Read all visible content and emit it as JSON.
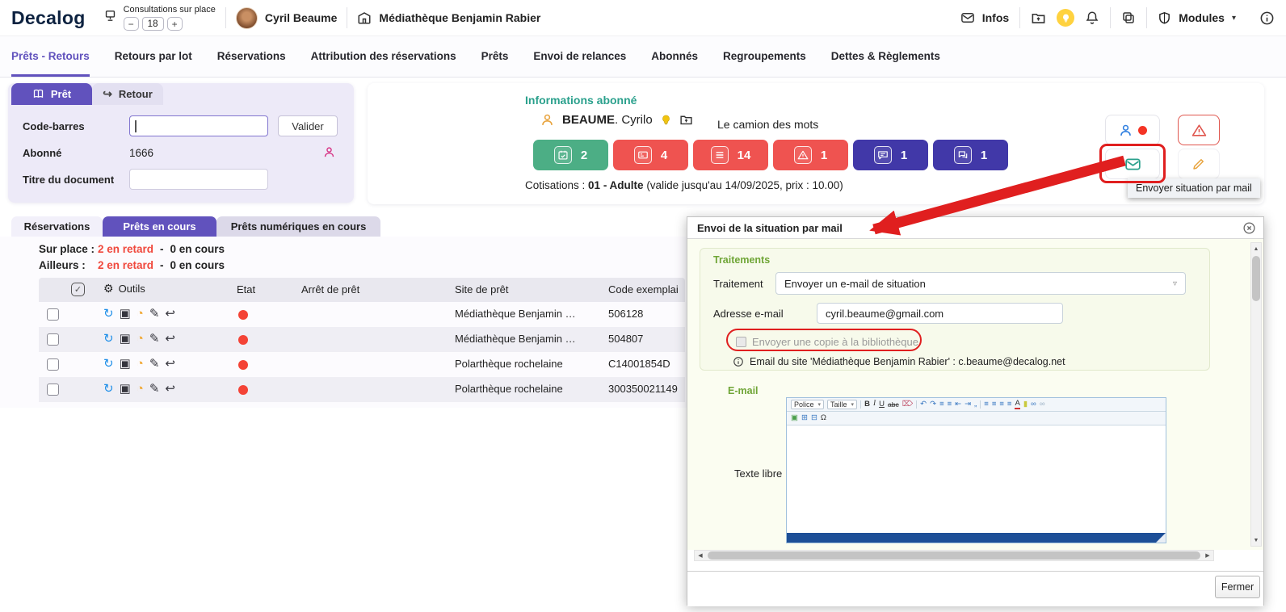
{
  "colors": {
    "accent_purple": "#6152bd",
    "teal_heading": "#2aa08c",
    "badge_green": "#4cae85",
    "badge_red": "#ef5350",
    "badge_indigo": "#4138a8",
    "status_red": "#f44336",
    "annotation_red": "#e01f1f",
    "green_section_title": "#6fa536"
  },
  "header": {
    "logo": "Decalog",
    "consultations": {
      "label": "Consultations sur place",
      "count": "18",
      "minus": "−",
      "plus": "+"
    },
    "user_name": "Cyril Beaume",
    "site_name": "Médiathèque Benjamin Rabier",
    "infos_label": "Infos",
    "modules_label": "Modules"
  },
  "nav": {
    "tabs": [
      {
        "label": "Prêts - Retours",
        "active": true
      },
      {
        "label": "Retours par lot"
      },
      {
        "label": "Réservations"
      },
      {
        "label": "Attribution des réservations"
      },
      {
        "label": "Prêts"
      },
      {
        "label": "Envoi de relances"
      },
      {
        "label": "Abonnés"
      },
      {
        "label": "Regroupements"
      },
      {
        "label": "Dettes & Règlements"
      }
    ]
  },
  "loan_panel": {
    "tab_pret": "Prêt",
    "tab_retour": "Retour",
    "barcode_label": "Code-barres",
    "valider_label": "Valider",
    "abonne_label": "Abonné",
    "abonne_value": "1666",
    "titre_label": "Titre du document"
  },
  "subscriber": {
    "section_title": "Informations abonné",
    "name_bold": "BEAUME",
    "name_rest": ". Cyrilo",
    "subtitle": "Le camion des mots",
    "badges": [
      {
        "icon": "calendar-check",
        "value": "2"
      },
      {
        "icon": "card",
        "value": "4"
      },
      {
        "icon": "books",
        "value": "14"
      },
      {
        "icon": "warning",
        "value": "1"
      },
      {
        "icon": "comment",
        "value": "1"
      },
      {
        "icon": "chat",
        "value": "1"
      }
    ],
    "cotisations_prefix": "Cotisations : ",
    "cotisations_bold": "01 - Adulte",
    "cotisations_suffix": " (valide jusqu'au 14/09/2025, prix : 10.00)",
    "tooltip": "Envoyer situation par mail"
  },
  "loans": {
    "tabs": [
      {
        "label": "Réservations"
      },
      {
        "label": "Prêts en cours",
        "active": true
      },
      {
        "label": "Prêts numériques en cours"
      }
    ],
    "summary": [
      {
        "label": "Sur place :",
        "late": "2 en retard",
        "sep": "-",
        "current": "0 en cours"
      },
      {
        "label": "Ailleurs :",
        "late": "2 en retard",
        "sep": "-",
        "current": "0 en cours"
      }
    ],
    "table": {
      "outils_label": "Outils",
      "headers": {
        "etat": "Etat",
        "arret": "Arrêt de prêt",
        "site": "Site de prêt",
        "code": "Code exemplai"
      },
      "rows": [
        {
          "site": "Médiathèque Benjamin …",
          "code": "506128"
        },
        {
          "site": "Médiathèque Benjamin …",
          "code": "504807"
        },
        {
          "site": "Polarthèque rochelaine",
          "code": "C14001854D"
        },
        {
          "site": "Polarthèque rochelaine",
          "code": "300350021149"
        }
      ]
    }
  },
  "modal": {
    "title": "Envoi de la situation par mail",
    "traitements_title": "Traitements",
    "traitement_label": "Traitement",
    "traitement_value": "Envoyer un e-mail de situation",
    "email_label": "Adresse e-mail",
    "email_value": "cyril.beaume@gmail.com",
    "copy_label": "Envoyer une copie à la bibliothèque",
    "note": "Email du site 'Médiathèque Benjamin Rabier' : c.beaume@decalog.net",
    "email_section": "E-mail",
    "texte_libre_label": "Texte libre",
    "editor": {
      "police": "Police",
      "taille": "Taille"
    },
    "fermer_label": "Fermer"
  }
}
